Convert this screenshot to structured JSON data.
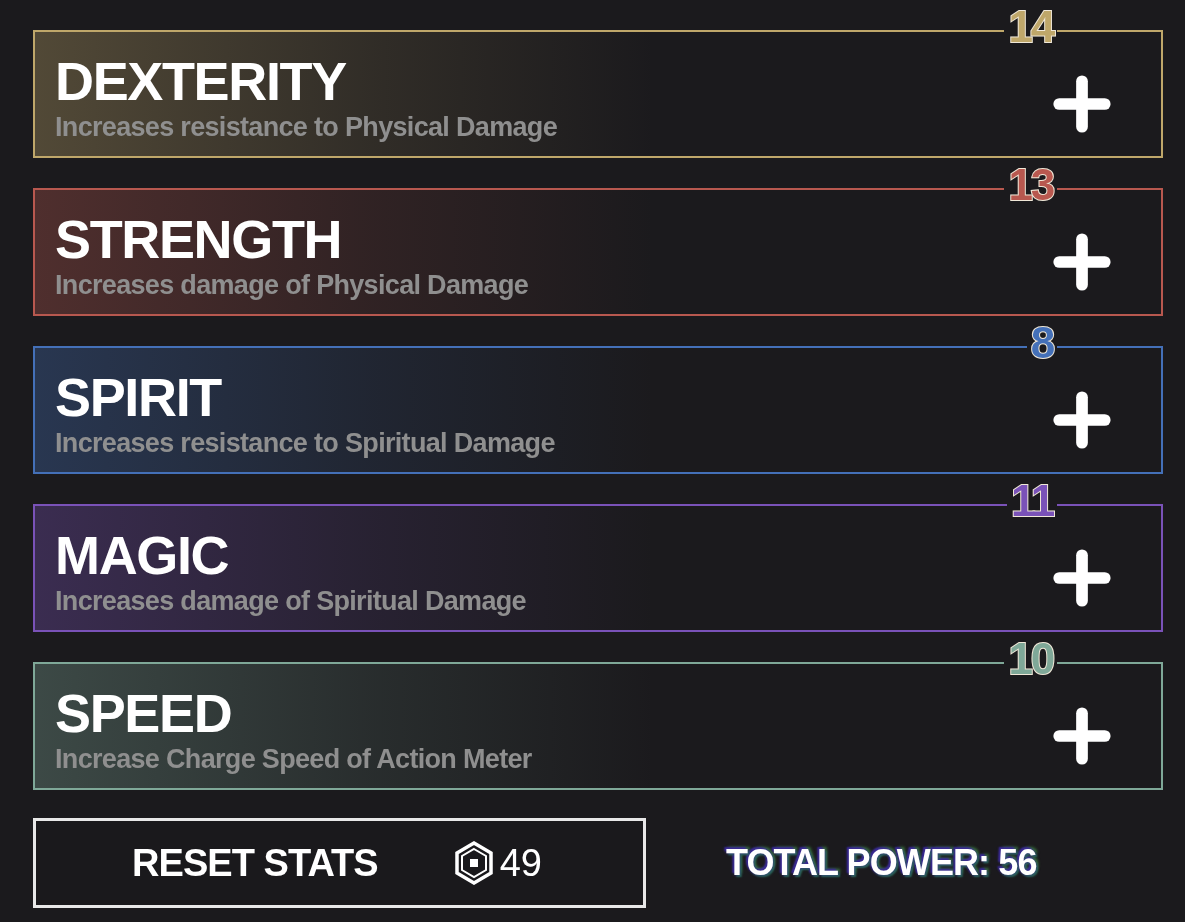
{
  "stats": [
    {
      "name": "DEXTERITY",
      "description": "Increases resistance to Physical Damage",
      "points": "14",
      "color": "#bfa76a"
    },
    {
      "name": "STRENGTH",
      "description": "Increases damage of Physical Damage",
      "points": "13",
      "color": "#b8584f"
    },
    {
      "name": "SPIRIT",
      "description": "Increases resistance to Spiritual Damage",
      "points": "8",
      "color": "#4470b8"
    },
    {
      "name": "MAGIC",
      "description": "Increases damage of Spiritual Damage",
      "points": "11",
      "color": "#7a52b8"
    },
    {
      "name": "SPEED",
      "description": "Increase Charge Speed of Action Meter",
      "points": "10",
      "color": "#7fa898"
    }
  ],
  "reset_button": {
    "label": "RESET STATS",
    "cost": "49"
  },
  "total_power": "TOTAL POWER: 56"
}
